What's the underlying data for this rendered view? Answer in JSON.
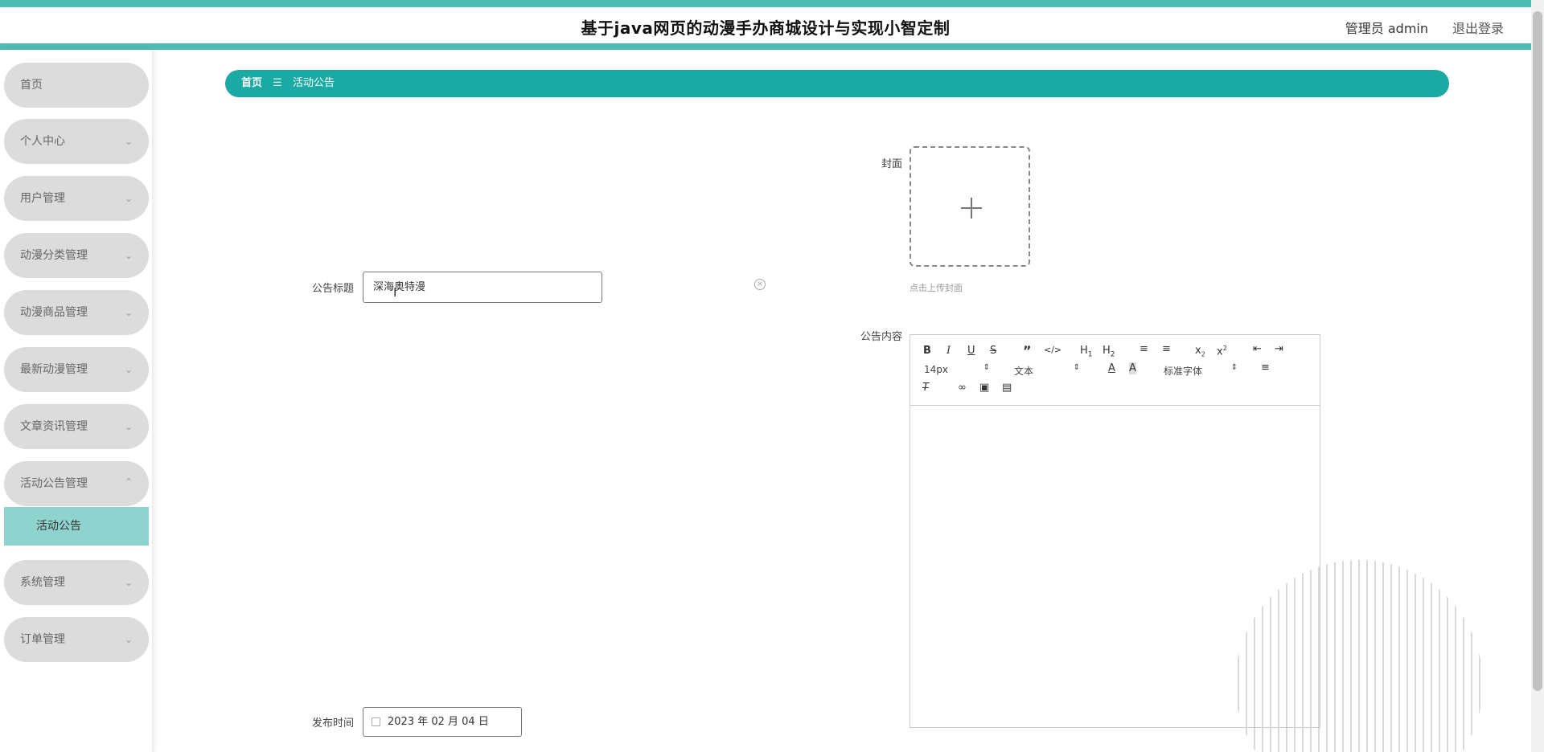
{
  "header": {
    "title": "基于java网页的动漫手办商城设计与实现小智定制",
    "user": "管理员 admin",
    "logout": "退出登录"
  },
  "sidebar": {
    "items": [
      {
        "label": "首页",
        "expandable": false
      },
      {
        "label": "个人中心",
        "expandable": true
      },
      {
        "label": "用户管理",
        "expandable": true
      },
      {
        "label": "动漫分类管理",
        "expandable": true
      },
      {
        "label": "动漫商品管理",
        "expandable": true
      },
      {
        "label": "最新动漫管理",
        "expandable": true
      },
      {
        "label": "文章资讯管理",
        "expandable": true
      },
      {
        "label": "活动公告管理",
        "expandable": true,
        "expanded": true
      },
      {
        "label": "系统管理",
        "expandable": true
      },
      {
        "label": "订单管理",
        "expandable": true
      }
    ],
    "active_sub": "活动公告"
  },
  "breadcrumb": {
    "home": "首页",
    "separator": "☰",
    "current": "活动公告"
  },
  "form": {
    "title_label": "公告标题",
    "title_value": "深海奥特漫",
    "cover_label": "封面",
    "cover_tip": "点击上传封面",
    "content_label": "公告内容",
    "date_label": "发布时间",
    "date_value": "2023 年 02 月 04 日"
  },
  "editor": {
    "font_size": "14px",
    "paragraph": "文本",
    "font_family": "标准字体",
    "buttons": [
      "bold-icon",
      "italic-icon",
      "underline-icon",
      "strikethrough-icon",
      "blockquote-icon",
      "code-icon",
      "h1-icon",
      "h2-icon",
      "ordered-list-icon",
      "bullet-list-icon",
      "subscript-icon",
      "superscript-icon",
      "outdent-icon",
      "indent-icon",
      "font-color-icon",
      "background-color-icon",
      "align-icon",
      "clear-format-icon",
      "link-icon",
      "image-icon",
      "video-icon"
    ]
  },
  "colors": {
    "accent": "#1ba9a4",
    "header_border": "#4dbdb4",
    "submenu_active": "#8fd3cf",
    "menu_bg": "#dcdcdc"
  }
}
